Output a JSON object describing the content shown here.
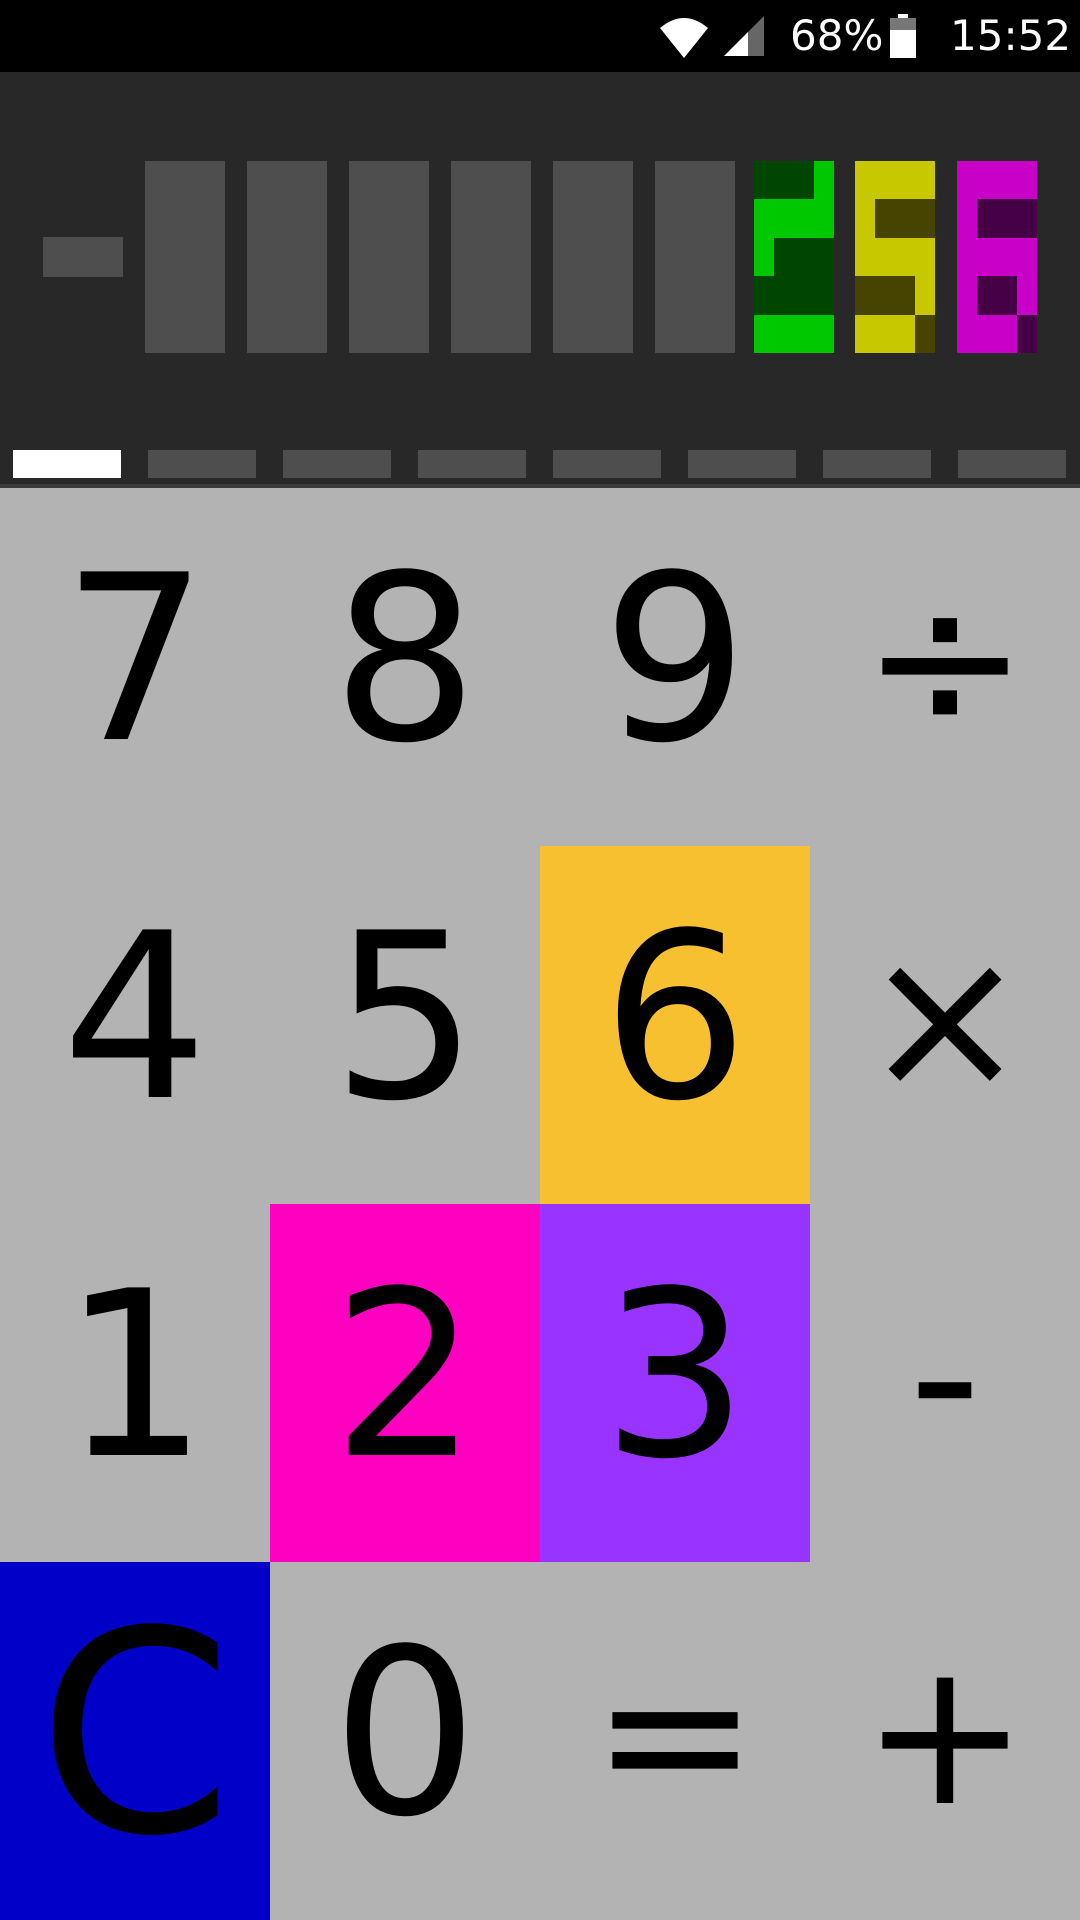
{
  "status_bar": {
    "battery_percent": "68%",
    "time": "15:52",
    "icons": [
      "wifi-icon",
      "signal-icon",
      "battery-icon"
    ]
  },
  "display": {
    "sign": "-",
    "value": "256",
    "digits": [
      {
        "char": "",
        "color": "#4e4e4e"
      },
      {
        "char": "",
        "color": "#4e4e4e"
      },
      {
        "char": "",
        "color": "#4e4e4e"
      },
      {
        "char": "",
        "color": "#4e4e4e"
      },
      {
        "char": "",
        "color": "#4e4e4e"
      },
      {
        "char": "",
        "color": "#4e4e4e"
      },
      {
        "char": "2",
        "color": "#00c800",
        "dark": "#004600"
      },
      {
        "char": "5",
        "color": "#c8c800",
        "dark": "#464400"
      },
      {
        "char": "6",
        "color": "#c800c8",
        "dark": "#460046"
      }
    ],
    "pages": 8,
    "active_page": 0
  },
  "keypad": {
    "keys": [
      {
        "label": "7",
        "name": "key-7",
        "bg": "transparent"
      },
      {
        "label": "8",
        "name": "key-8",
        "bg": "transparent"
      },
      {
        "label": "9",
        "name": "key-9",
        "bg": "transparent"
      },
      {
        "label": "÷",
        "name": "key-divide",
        "bg": "transparent"
      },
      {
        "label": "4",
        "name": "key-4",
        "bg": "transparent"
      },
      {
        "label": "5",
        "name": "key-5",
        "bg": "transparent"
      },
      {
        "label": "6",
        "name": "key-6",
        "bg": "#f7c030"
      },
      {
        "label": "×",
        "name": "key-multiply",
        "bg": "transparent"
      },
      {
        "label": "1",
        "name": "key-1",
        "bg": "transparent"
      },
      {
        "label": "2",
        "name": "key-2",
        "bg": "#ff00c0"
      },
      {
        "label": "3",
        "name": "key-3",
        "bg": "#9933ff"
      },
      {
        "label": "-",
        "name": "key-minus",
        "bg": "transparent"
      },
      {
        "label": "C",
        "name": "key-clear",
        "bg": "#0000c8"
      },
      {
        "label": "0",
        "name": "key-0",
        "bg": "transparent"
      },
      {
        "label": "=",
        "name": "key-equals",
        "bg": "transparent"
      },
      {
        "label": "+",
        "name": "key-plus",
        "bg": "transparent"
      }
    ]
  }
}
